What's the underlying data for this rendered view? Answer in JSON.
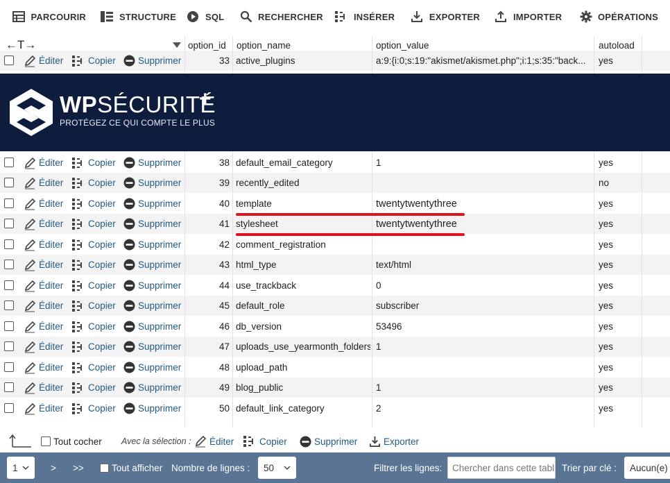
{
  "tabs": [
    {
      "label": "PARCOURIR",
      "icon": "browse-icon",
      "active": true
    },
    {
      "label": "STRUCTURE",
      "icon": "structure-icon"
    },
    {
      "label": "SQL",
      "icon": "sql-play-icon"
    },
    {
      "label": "RECHERCHER",
      "icon": "search-icon"
    },
    {
      "label": "INSÉRER",
      "icon": "insert-icon"
    },
    {
      "label": "EXPORTER",
      "icon": "export-icon"
    },
    {
      "label": "IMPORTER",
      "icon": "import-icon"
    },
    {
      "label": "OPÉRATIONS",
      "icon": "gear-icon"
    }
  ],
  "table": {
    "resize_arrows": "←T→",
    "columns": [
      "option_id",
      "option_name",
      "option_value",
      "autoload"
    ],
    "action_labels": {
      "edit": "Éditer",
      "copy": "Copier",
      "delete": "Supprimer"
    },
    "rows": [
      {
        "id": "33",
        "name": "active_plugins",
        "value": "a:9:{i:0;s:19:\"akismet/akismet.php\";i:1;s:35:\"back...",
        "autoload": "yes"
      },
      {
        "id": "38",
        "name": "default_email_category",
        "value": "1",
        "autoload": "yes"
      },
      {
        "id": "39",
        "name": "recently_edited",
        "value": "",
        "autoload": "no"
      },
      {
        "id": "40",
        "name": "template",
        "value": "twentytwentythree",
        "autoload": "yes"
      },
      {
        "id": "41",
        "name": "stylesheet",
        "value": "twentytwentythree",
        "autoload": "yes"
      },
      {
        "id": "42",
        "name": "comment_registration",
        "value": "",
        "autoload": "yes"
      },
      {
        "id": "43",
        "name": "html_type",
        "value": "text/html",
        "autoload": "yes"
      },
      {
        "id": "44",
        "name": "use_trackback",
        "value": "0",
        "autoload": "yes"
      },
      {
        "id": "45",
        "name": "default_role",
        "value": "subscriber",
        "autoload": "yes"
      },
      {
        "id": "46",
        "name": "db_version",
        "value": "53496",
        "autoload": "yes"
      },
      {
        "id": "47",
        "name": "uploads_use_yearmonth_folders",
        "value": "1",
        "autoload": "yes"
      },
      {
        "id": "48",
        "name": "upload_path",
        "value": "",
        "autoload": "yes"
      },
      {
        "id": "49",
        "name": "blog_public",
        "value": "1",
        "autoload": "yes"
      },
      {
        "id": "50",
        "name": "default_link_category",
        "value": "2",
        "autoload": "yes"
      }
    ]
  },
  "banner": {
    "brand_bold": "WP",
    "brand_thin": "SÉCURITÉ",
    "plus": "+",
    "tagline": "PROTÉGEZ CE QUI COMPTE LE PLUS",
    "bg_color": "#0e1d3d"
  },
  "bulk": {
    "check_all": "Tout cocher",
    "with_selection": "Avec la sélection :",
    "edit": "Éditer",
    "copy": "Copier",
    "delete": "Supprimer",
    "export": "Exporter"
  },
  "footer": {
    "page": "1",
    "next": ">",
    "last": ">>",
    "show_all": "Tout afficher",
    "rows_label": "Nombre de lignes :",
    "rows_value": "50",
    "filter_label": "Filtrer les lignes:",
    "filter_placeholder": "Chercher dans cette tabl",
    "sort_label": "Trier par clé :",
    "sort_value": "Aucun(e)"
  },
  "colors": {
    "link": "#235a81",
    "footer": "#5a7493",
    "highlight": "#e0141e"
  }
}
